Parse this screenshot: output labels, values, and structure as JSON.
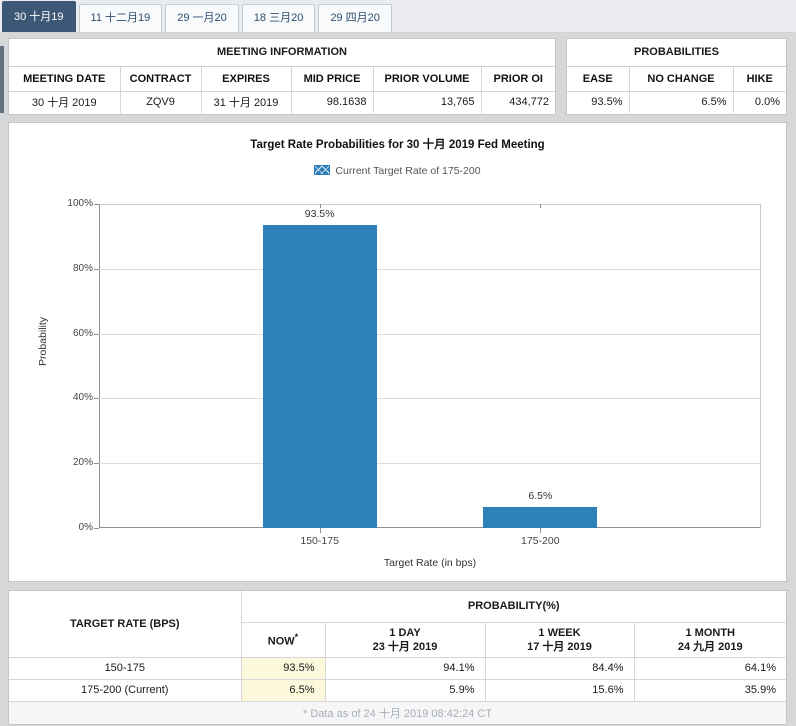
{
  "tabs": [
    {
      "label": "30 十月19",
      "selected": true
    },
    {
      "label": "11 十二月19",
      "selected": false
    },
    {
      "label": "29 一月20",
      "selected": false
    },
    {
      "label": "18 三月20",
      "selected": false
    },
    {
      "label": "29 四月20",
      "selected": false
    }
  ],
  "meeting_information": {
    "title": "MEETING INFORMATION",
    "headers": [
      "MEETING DATE",
      "CONTRACT",
      "EXPIRES",
      "MID PRICE",
      "PRIOR VOLUME",
      "PRIOR OI"
    ],
    "values": [
      "30 十月 2019",
      "ZQV9",
      "31 十月 2019",
      "98.1638",
      "13,765",
      "434,772"
    ]
  },
  "probabilities_panel": {
    "title": "PROBABILITIES",
    "headers": [
      "EASE",
      "NO CHANGE",
      "HIKE"
    ],
    "values": [
      "93.5%",
      "6.5%",
      "0.0%"
    ]
  },
  "chart_data": {
    "type": "bar",
    "title": "Target Rate Probabilities for 30 十月 2019 Fed Meeting",
    "legend": "Current Target Rate of 175-200",
    "categories": [
      "150-175",
      "175-200"
    ],
    "values": [
      93.5,
      6.5
    ],
    "bar_labels": [
      "93.5%",
      "6.5%"
    ],
    "hatched": [
      false,
      true
    ],
    "xlabel": "Target Rate (in bps)",
    "ylabel": "Probability",
    "ylim": [
      0,
      100
    ],
    "yticks": [
      "0%",
      "20%",
      "40%",
      "60%",
      "80%",
      "100%"
    ],
    "grid": true,
    "legend_position": "top",
    "bar_color": "#2d80b9"
  },
  "history_table": {
    "col1_header": "TARGET RATE (BPS)",
    "group_header": "PROBABILITY(%)",
    "sub_headers": [
      {
        "line1": "NOW",
        "sup": "*",
        "line2": ""
      },
      {
        "line1": "1 DAY",
        "line2": "23 十月 2019"
      },
      {
        "line1": "1 WEEK",
        "line2": "17 十月 2019"
      },
      {
        "line1": "1 MONTH",
        "line2": "24 九月 2019"
      }
    ],
    "rows": [
      {
        "rate": "150-175",
        "now": "93.5%",
        "day": "94.1%",
        "week": "84.4%",
        "month": "64.1%"
      },
      {
        "rate": "175-200 (Current)",
        "now": "6.5%",
        "day": "5.9%",
        "week": "15.6%",
        "month": "35.9%"
      }
    ],
    "footnote": "* Data as of 24 十月 2019 08:42:24 CT"
  },
  "colors": {
    "selected_tab": "#3d5877",
    "bar_blue": "#2d80b9",
    "now_highlight": "#fcf8dc",
    "gridline": "#dcdcdc"
  }
}
